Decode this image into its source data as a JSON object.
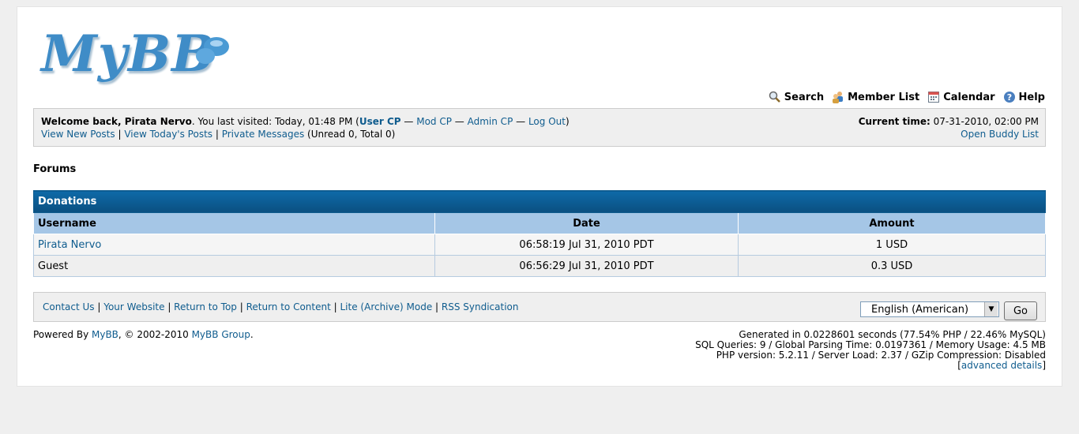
{
  "logo": {
    "text": "MyBB"
  },
  "toplinks": [
    {
      "label": "Search",
      "icon": "search-icon"
    },
    {
      "label": "Member List",
      "icon": "members-icon"
    },
    {
      "label": "Calendar",
      "icon": "calendar-icon"
    },
    {
      "label": "Help",
      "icon": "help-icon"
    }
  ],
  "panel": {
    "welcome": "Welcome back, Pirata Nervo",
    "last_visit": ". You last visited: Today, 01:48 PM (",
    "user_cp": "User CP",
    "sep1": " — ",
    "mod_cp": "Mod CP",
    "sep2": " — ",
    "admin_cp": "Admin CP",
    "sep3": " — ",
    "logout": "Log Out",
    "close_paren": ")",
    "view_new_posts": "View New Posts",
    "pipe1": " | ",
    "view_today": "View Today's Posts",
    "pipe2": " | ",
    "private_messages": "Private Messages",
    "pm_counts": " (Unread 0, Total 0)",
    "current_time_label": "Current time:",
    "current_time_value": " 07-31-2010, 02:00 PM",
    "buddy_list": "Open Buddy List"
  },
  "breadcrumb": {
    "title": "Forums"
  },
  "donations": {
    "title": "Donations",
    "columns": [
      "Username",
      "Date",
      "Amount"
    ],
    "rows": [
      {
        "username": "Pirata Nervo",
        "date": "06:58:19 Jul 31, 2010 PDT",
        "amount": "1 USD"
      },
      {
        "username": "Guest",
        "date": "06:56:29 Jul 31, 2010 PDT",
        "amount": "0.3 USD"
      }
    ]
  },
  "footer": {
    "links": [
      "Contact Us",
      "Your Website",
      "Return to Top",
      "Return to Content",
      "Lite (Archive) Mode",
      "RSS Syndication"
    ],
    "language_selected": "English (American)",
    "go_label": "Go"
  },
  "powered": {
    "prefix": "Powered By ",
    "mybb": "MyBB",
    "middle": ", © 2002-2010 ",
    "group": "MyBB Group",
    "suffix": "."
  },
  "debug": {
    "line1": "Generated in 0.0228601 seconds (77.54% PHP / 22.46% MySQL)",
    "line2": "SQL Queries: 9 / Global Parsing Time: 0.0197361 / Memory Usage: 4.5 MB",
    "line3": "PHP version: 5.2.11 / Server Load: 2.37 / GZip Compression: Disabled",
    "open_bracket": "[",
    "advanced": "advanced details",
    "close_bracket": "]"
  },
  "colors": {
    "accent": "#0f5c8e",
    "thead": "#0a4f80",
    "tcat": "#a5c6e6",
    "background": "#efefef"
  }
}
